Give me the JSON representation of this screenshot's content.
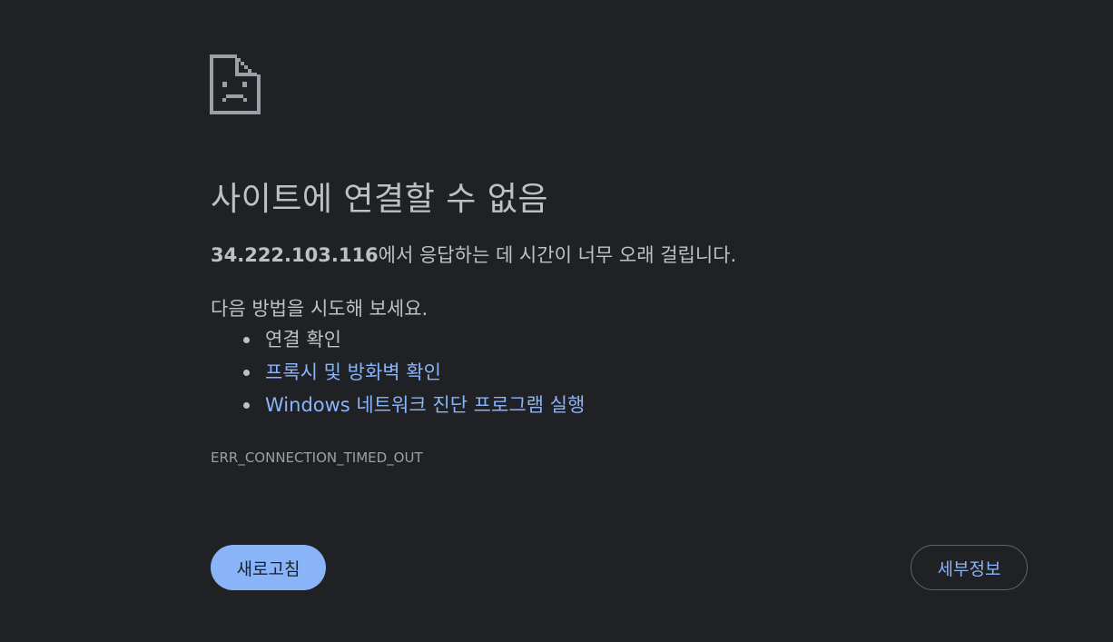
{
  "error": {
    "title": "사이트에 연결할 수 없음",
    "host": "34.222.103.116",
    "summary_suffix": "에서 응답하는 데 시간이 너무 오래 걸립니다.",
    "suggestions_heading": "다음 방법을 시도해 보세요.",
    "suggestions": [
      {
        "label": "연결 확인",
        "is_link": false
      },
      {
        "label": "프록시 및 방화벽 확인",
        "is_link": true
      },
      {
        "label": "Windows 네트워크 진단 프로그램 실행",
        "is_link": true
      }
    ],
    "code": "ERR_CONNECTION_TIMED_OUT"
  },
  "buttons": {
    "reload_label": "새로고침",
    "details_label": "세부정보"
  },
  "icons": {
    "error": "sad-page-icon"
  },
  "colors": {
    "background": "#202124",
    "text": "#bdc1c6",
    "link": "#8ab4f8",
    "primary_button": "#8ab4f8",
    "secondary_border": "#5f6368"
  }
}
